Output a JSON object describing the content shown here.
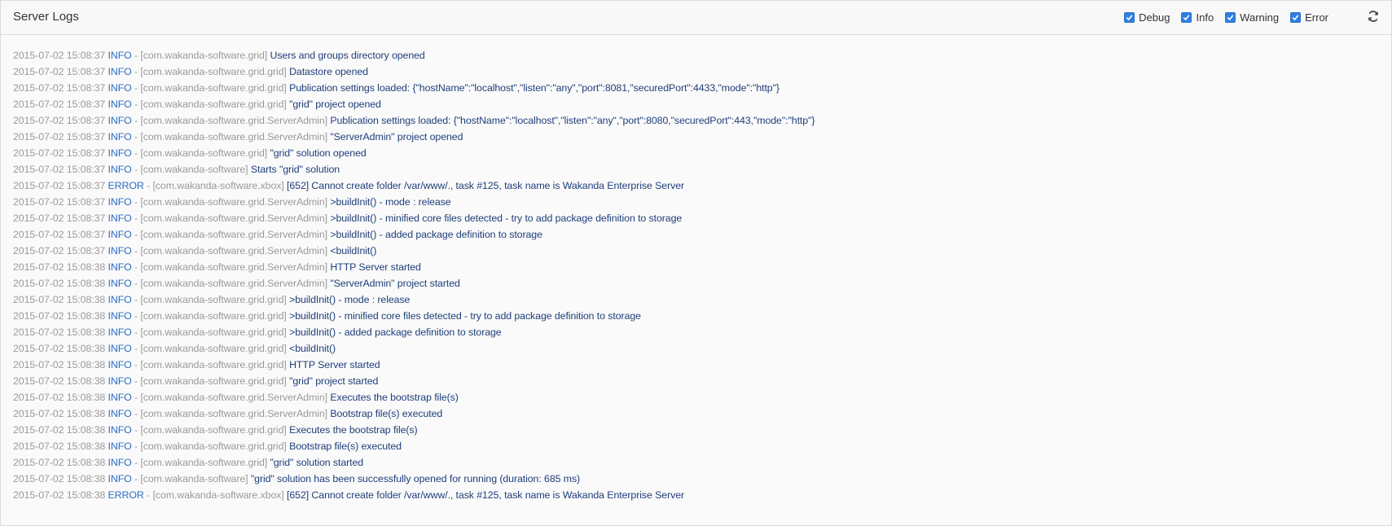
{
  "header": {
    "title": "Server Logs",
    "filters": [
      {
        "label": "Debug",
        "checked": true
      },
      {
        "label": "Info",
        "checked": true
      },
      {
        "label": "Warning",
        "checked": true
      },
      {
        "label": "Error",
        "checked": true
      }
    ],
    "refresh_icon": "refresh-icon"
  },
  "colors": {
    "timestamp": "#9a9a9a",
    "level": "#2b6cc4",
    "message": "#1f3f7a",
    "checkbox": "#2f7fe0"
  },
  "logs": [
    {
      "ts": "2015-07-02 15:08:37",
      "level": "INFO",
      "source": "[com.wakanda-software.grid]",
      "message": "Users and groups directory opened"
    },
    {
      "ts": "2015-07-02 15:08:37",
      "level": "INFO",
      "source": "[com.wakanda-software.grid.grid]",
      "message": "Datastore opened"
    },
    {
      "ts": "2015-07-02 15:08:37",
      "level": "INFO",
      "source": "[com.wakanda-software.grid.grid]",
      "message": "Publication settings loaded: {\"hostName\":\"localhost\",\"listen\":\"any\",\"port\":8081,\"securedPort\":4433,\"mode\":\"http\"}"
    },
    {
      "ts": "2015-07-02 15:08:37",
      "level": "INFO",
      "source": "[com.wakanda-software.grid.grid]",
      "message": "\"grid\" project opened"
    },
    {
      "ts": "2015-07-02 15:08:37",
      "level": "INFO",
      "source": "[com.wakanda-software.grid.ServerAdmin]",
      "message": "Publication settings loaded: {\"hostName\":\"localhost\",\"listen\":\"any\",\"port\":8080,\"securedPort\":443,\"mode\":\"http\"}"
    },
    {
      "ts": "2015-07-02 15:08:37",
      "level": "INFO",
      "source": "[com.wakanda-software.grid.ServerAdmin]",
      "message": "\"ServerAdmin\" project opened"
    },
    {
      "ts": "2015-07-02 15:08:37",
      "level": "INFO",
      "source": "[com.wakanda-software.grid]",
      "message": "\"grid\" solution opened"
    },
    {
      "ts": "2015-07-02 15:08:37",
      "level": "INFO",
      "source": "[com.wakanda-software]",
      "message": "Starts \"grid\" solution"
    },
    {
      "ts": "2015-07-02 15:08:37",
      "level": "ERROR",
      "source": "[com.wakanda-software.xbox]",
      "message": "[652] Cannot create folder /var/www/., task #125, task name is Wakanda Enterprise Server"
    },
    {
      "ts": "2015-07-02 15:08:37",
      "level": "INFO",
      "source": "[com.wakanda-software.grid.ServerAdmin]",
      "message": ">buildInit() - mode : release"
    },
    {
      "ts": "2015-07-02 15:08:37",
      "level": "INFO",
      "source": "[com.wakanda-software.grid.ServerAdmin]",
      "message": ">buildInit() - minified core files detected - try to add package definition to storage"
    },
    {
      "ts": "2015-07-02 15:08:37",
      "level": "INFO",
      "source": "[com.wakanda-software.grid.ServerAdmin]",
      "message": ">buildInit() - added package definition to storage"
    },
    {
      "ts": "2015-07-02 15:08:37",
      "level": "INFO",
      "source": "[com.wakanda-software.grid.ServerAdmin]",
      "message": "<buildInit()"
    },
    {
      "ts": "2015-07-02 15:08:38",
      "level": "INFO",
      "source": "[com.wakanda-software.grid.ServerAdmin]",
      "message": "HTTP Server started"
    },
    {
      "ts": "2015-07-02 15:08:38",
      "level": "INFO",
      "source": "[com.wakanda-software.grid.ServerAdmin]",
      "message": "\"ServerAdmin\" project started"
    },
    {
      "ts": "2015-07-02 15:08:38",
      "level": "INFO",
      "source": "[com.wakanda-software.grid.grid]",
      "message": ">buildInit() - mode : release"
    },
    {
      "ts": "2015-07-02 15:08:38",
      "level": "INFO",
      "source": "[com.wakanda-software.grid.grid]",
      "message": ">buildInit() - minified core files detected - try to add package definition to storage"
    },
    {
      "ts": "2015-07-02 15:08:38",
      "level": "INFO",
      "source": "[com.wakanda-software.grid.grid]",
      "message": ">buildInit() - added package definition to storage"
    },
    {
      "ts": "2015-07-02 15:08:38",
      "level": "INFO",
      "source": "[com.wakanda-software.grid.grid]",
      "message": "<buildInit()"
    },
    {
      "ts": "2015-07-02 15:08:38",
      "level": "INFO",
      "source": "[com.wakanda-software.grid.grid]",
      "message": "HTTP Server started"
    },
    {
      "ts": "2015-07-02 15:08:38",
      "level": "INFO",
      "source": "[com.wakanda-software.grid.grid]",
      "message": "\"grid\" project started"
    },
    {
      "ts": "2015-07-02 15:08:38",
      "level": "INFO",
      "source": "[com.wakanda-software.grid.ServerAdmin]",
      "message": "Executes the bootstrap file(s)"
    },
    {
      "ts": "2015-07-02 15:08:38",
      "level": "INFO",
      "source": "[com.wakanda-software.grid.ServerAdmin]",
      "message": "Bootstrap file(s) executed"
    },
    {
      "ts": "2015-07-02 15:08:38",
      "level": "INFO",
      "source": "[com.wakanda-software.grid.grid]",
      "message": "Executes the bootstrap file(s)"
    },
    {
      "ts": "2015-07-02 15:08:38",
      "level": "INFO",
      "source": "[com.wakanda-software.grid.grid]",
      "message": "Bootstrap file(s) executed"
    },
    {
      "ts": "2015-07-02 15:08:38",
      "level": "INFO",
      "source": "[com.wakanda-software.grid]",
      "message": "\"grid\" solution started"
    },
    {
      "ts": "2015-07-02 15:08:38",
      "level": "INFO",
      "source": "[com.wakanda-software]",
      "message": "\"grid\" solution has been successfully opened for running (duration: 685 ms)"
    },
    {
      "ts": "2015-07-02 15:08:38",
      "level": "ERROR",
      "source": "[com.wakanda-software.xbox]",
      "message": "[652] Cannot create folder /var/www/., task #125, task name is Wakanda Enterprise Server"
    }
  ]
}
